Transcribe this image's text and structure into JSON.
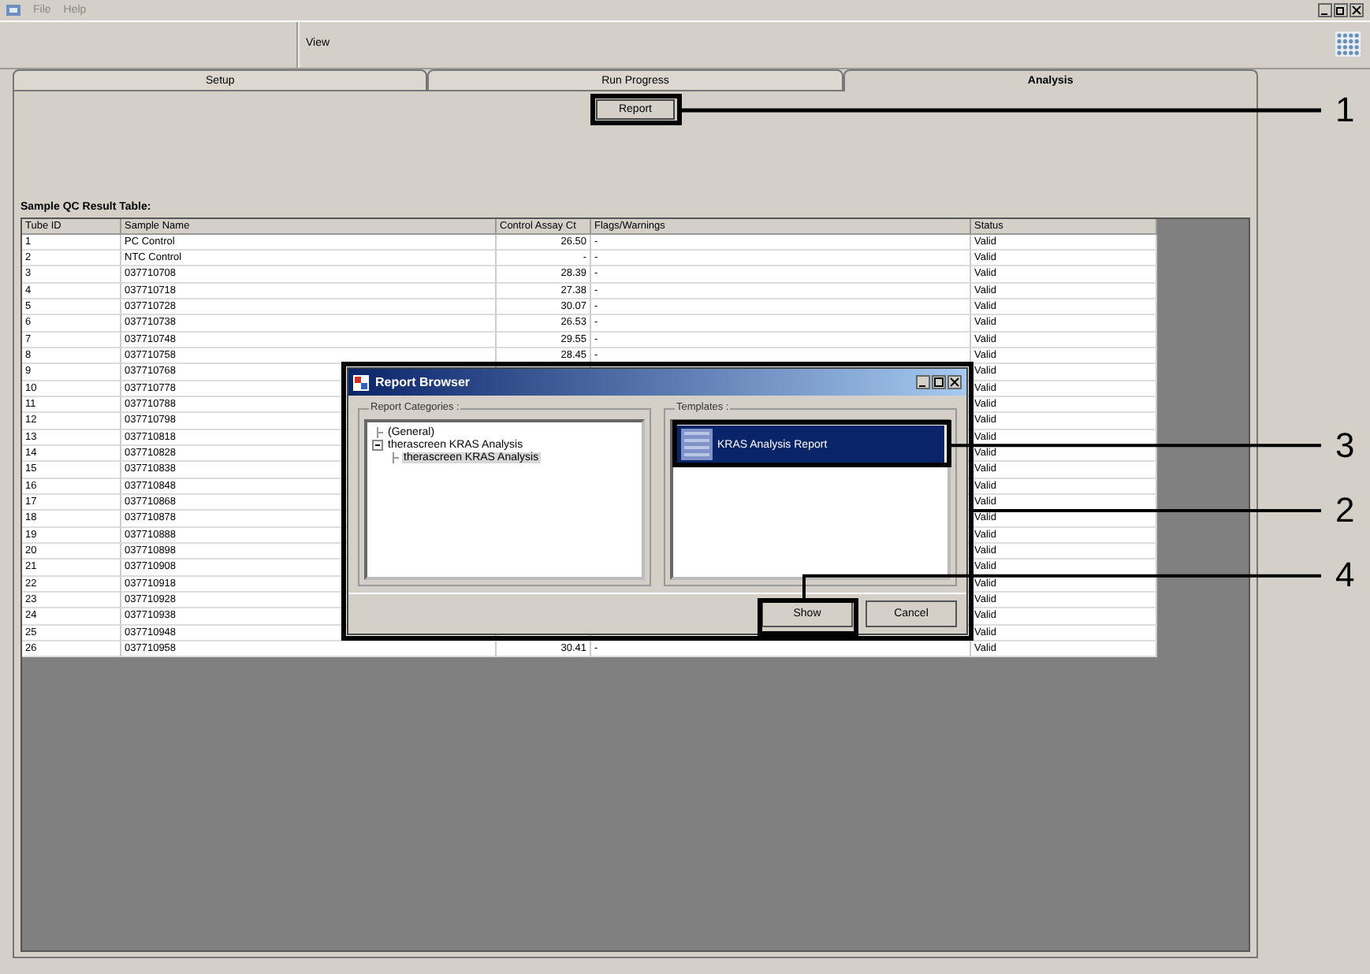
{
  "menu": [
    "File",
    "Help"
  ],
  "toolbar": {
    "label": "View"
  },
  "tabs": [
    {
      "label": "Setup",
      "selected": false
    },
    {
      "label": "Run Progress",
      "selected": false
    },
    {
      "label": "Analysis",
      "selected": true
    }
  ],
  "report_button": "Report",
  "table": {
    "title": "Sample QC Result Table:",
    "columns": [
      "Tube ID",
      "Sample Name",
      "Control Assay Ct",
      "Flags/Warnings",
      "Status"
    ],
    "rows": [
      {
        "tube": "1",
        "name": "PC Control",
        "ct": "26.50",
        "flags": "-",
        "status": "Valid"
      },
      {
        "tube": "2",
        "name": "NTC Control",
        "ct": "-",
        "flags": "-",
        "status": "Valid"
      },
      {
        "tube": "3",
        "name": "037710708",
        "ct": "28.39",
        "flags": "-",
        "status": "Valid"
      },
      {
        "tube": "4",
        "name": "037710718",
        "ct": "27.38",
        "flags": "-",
        "status": "Valid"
      },
      {
        "tube": "5",
        "name": "037710728",
        "ct": "30.07",
        "flags": "-",
        "status": "Valid"
      },
      {
        "tube": "6",
        "name": "037710738",
        "ct": "26.53",
        "flags": "-",
        "status": "Valid"
      },
      {
        "tube": "7",
        "name": "037710748",
        "ct": "29.55",
        "flags": "-",
        "status": "Valid"
      },
      {
        "tube": "8",
        "name": "037710758",
        "ct": "28.45",
        "flags": "-",
        "status": "Valid"
      },
      {
        "tube": "9",
        "name": "037710768",
        "status": "Valid"
      },
      {
        "tube": "10",
        "name": "037710778",
        "status": "Valid"
      },
      {
        "tube": "11",
        "name": "037710788",
        "status": "Valid"
      },
      {
        "tube": "12",
        "name": "037710798",
        "status": "Valid"
      },
      {
        "tube": "13",
        "name": "037710818",
        "status": "Valid"
      },
      {
        "tube": "14",
        "name": "037710828",
        "status": "Valid"
      },
      {
        "tube": "15",
        "name": "037710838",
        "status": "Valid"
      },
      {
        "tube": "16",
        "name": "037710848",
        "status": "Valid"
      },
      {
        "tube": "17",
        "name": "037710868",
        "status": "Valid"
      },
      {
        "tube": "18",
        "name": "037710878",
        "status": "Valid"
      },
      {
        "tube": "19",
        "name": "037710888",
        "status": "Valid"
      },
      {
        "tube": "20",
        "name": "037710898",
        "status": "Valid"
      },
      {
        "tube": "21",
        "name": "037710908",
        "status": "Valid"
      },
      {
        "tube": "22",
        "name": "037710918",
        "status": "Valid"
      },
      {
        "tube": "23",
        "name": "037710928",
        "status": "Valid"
      },
      {
        "tube": "24",
        "name": "037710938",
        "status": "Valid"
      },
      {
        "tube": "25",
        "name": "037710948",
        "status": "Valid"
      },
      {
        "tube": "26",
        "name": "037710958",
        "ct": "30.41",
        "flags": "-",
        "status": "Valid"
      }
    ]
  },
  "dialog": {
    "title": "Report Browser",
    "categories": {
      "label": "Report Categories :",
      "tree": [
        {
          "label": "(General)"
        },
        {
          "label": "therascreen KRAS Analysis",
          "expanded": true,
          "selected": false,
          "children": [
            {
              "label": "therascreen KRAS Analysis",
              "selected": true
            }
          ]
        }
      ]
    },
    "templates": {
      "label": "Templates :",
      "items": [
        {
          "label": "KRAS Analysis Report",
          "selected": true
        }
      ]
    },
    "buttons": [
      "Show",
      "Cancel"
    ]
  },
  "callouts": [
    "1",
    "3",
    "2",
    "4"
  ]
}
